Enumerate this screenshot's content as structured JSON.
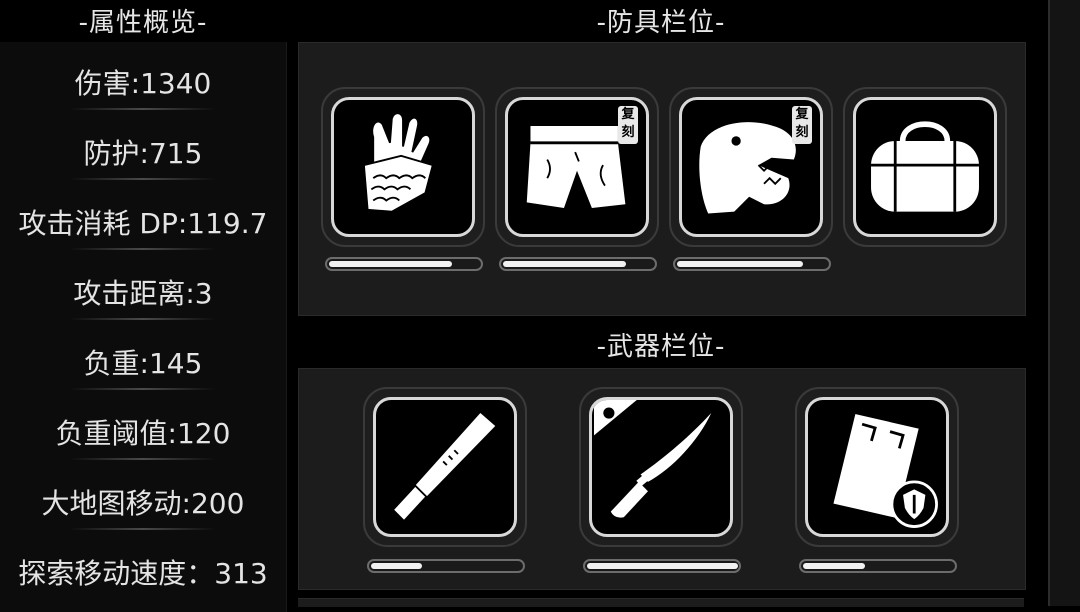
{
  "headers": {
    "stats": "-属性概览-",
    "armor": "-防具栏位-",
    "weapons": "-武器栏位-"
  },
  "stats": [
    "伤害:1340",
    "防护:715",
    "攻击消耗 DP:119.7",
    "攻击距离:3",
    "负重:145",
    "负重阈值:120",
    "大地图移动:200",
    "探索移动速度：313"
  ],
  "armor_slots": [
    {
      "icon": "gloves-icon",
      "durability": 0.8,
      "tag": null
    },
    {
      "icon": "shorts-icon",
      "durability": 0.8,
      "tag": "复刻"
    },
    {
      "icon": "dinosaur-head-icon",
      "durability": 0.82,
      "tag": "复刻"
    },
    {
      "icon": "duffel-bag-icon",
      "durability": null,
      "tag": null
    }
  ],
  "weapon_slots": [
    {
      "icon": "machete-icon",
      "durability": 0.33
    },
    {
      "icon": "knife-icon",
      "durability": 1.0
    },
    {
      "icon": "riot-shield-icon",
      "durability": 0.4
    }
  ]
}
